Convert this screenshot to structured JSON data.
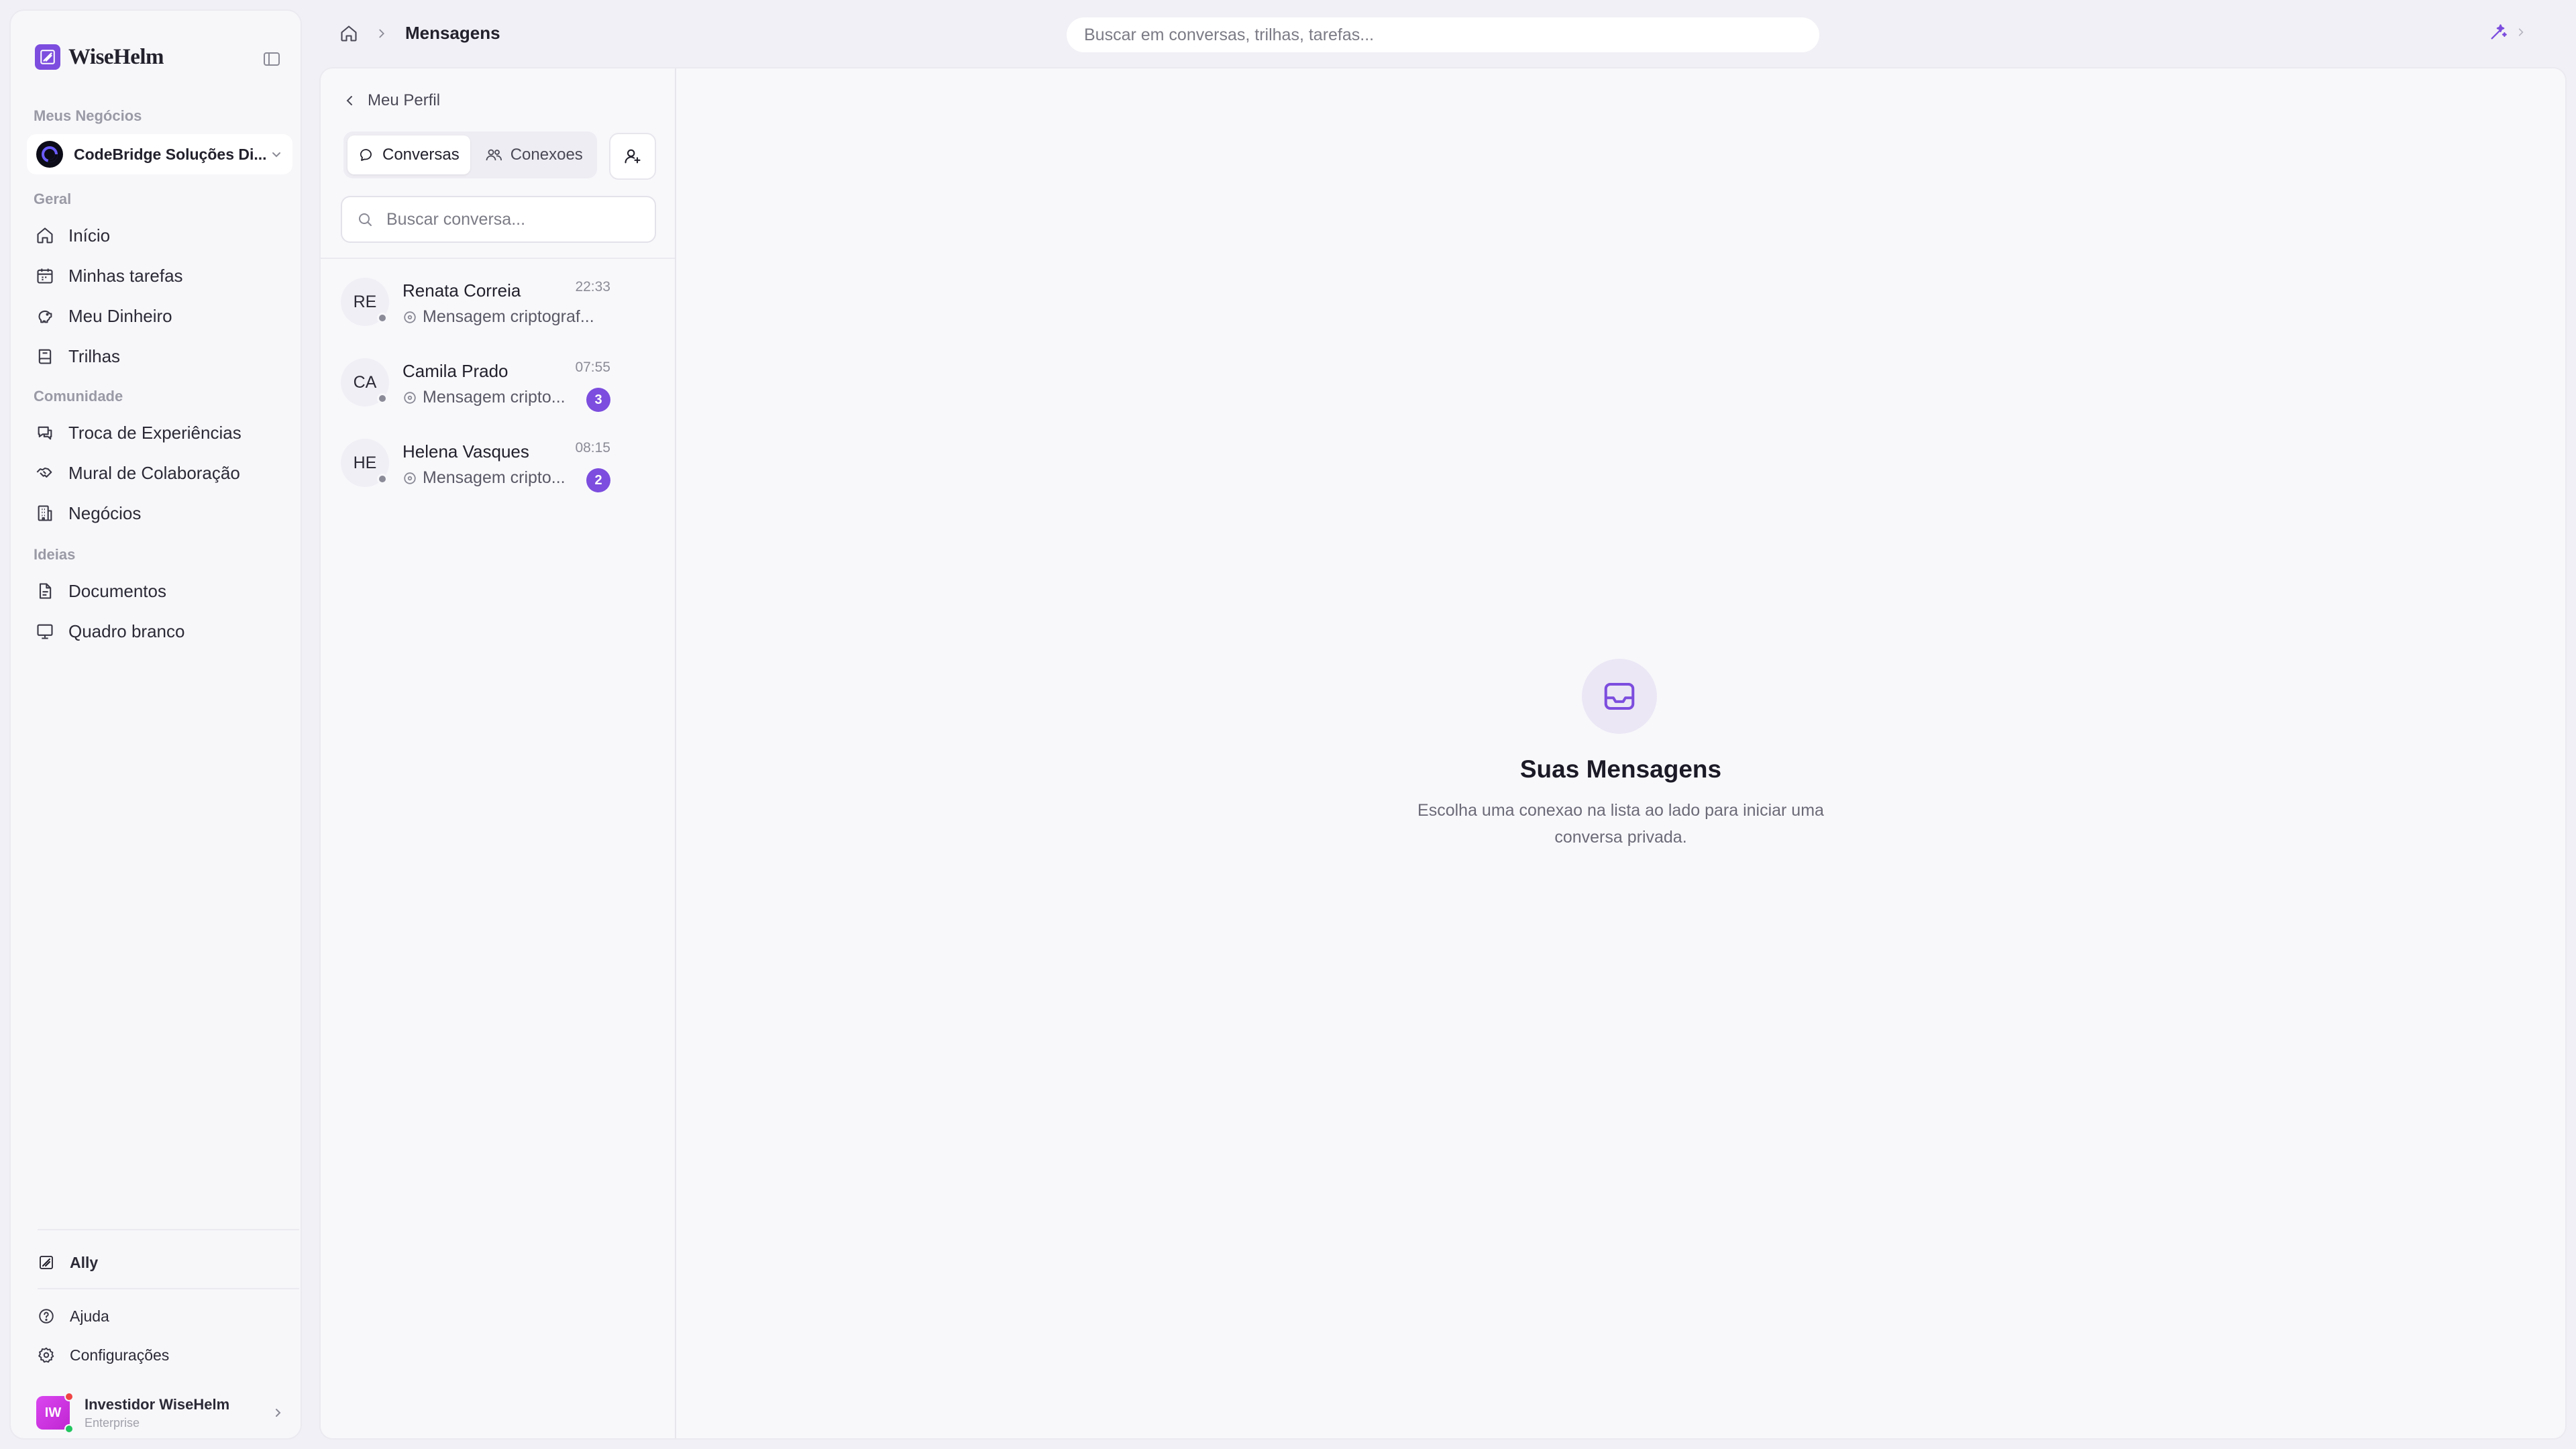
{
  "brand": {
    "name": "WiseHelm"
  },
  "sidebar": {
    "business_section": "Meus Negócios",
    "business_name": "CodeBridge Soluções Di...",
    "sections": [
      {
        "label": "Geral",
        "items": [
          {
            "label": "Início",
            "icon": "home-icon"
          },
          {
            "label": "Minhas tarefas",
            "icon": "calendar-icon"
          },
          {
            "label": "Meu Dinheiro",
            "icon": "piggy-bank-icon"
          },
          {
            "label": "Trilhas",
            "icon": "book-icon"
          }
        ]
      },
      {
        "label": "Comunidade",
        "items": [
          {
            "label": "Troca de Experiências",
            "icon": "chat-bubbles-icon"
          },
          {
            "label": "Mural de Colaboração",
            "icon": "handshake-icon"
          },
          {
            "label": "Negócios",
            "icon": "building-icon"
          }
        ]
      },
      {
        "label": "Ideias",
        "items": [
          {
            "label": "Documentos",
            "icon": "document-icon"
          },
          {
            "label": "Quadro branco",
            "icon": "whiteboard-icon"
          }
        ]
      }
    ],
    "bottom": {
      "ally": "Ally",
      "help": "Ajuda",
      "settings": "Configurações"
    },
    "user": {
      "initials": "IW",
      "name": "Investidor WiseHelm",
      "plan": "Enterprise"
    }
  },
  "topbar": {
    "breadcrumb_current": "Mensagens",
    "search_placeholder": "Buscar em conversas, trilhas, tarefas..."
  },
  "messages": {
    "back_label": "Meu Perfil",
    "tabs": [
      {
        "label": "Conversas",
        "active": true
      },
      {
        "label": "Conexoes",
        "active": false
      }
    ],
    "search_placeholder": "Buscar conversa...",
    "conversations": [
      {
        "initials": "RE",
        "name": "Renata Correia",
        "time": "22:33",
        "preview": "Mensagem criptograf...",
        "unread": ""
      },
      {
        "initials": "CA",
        "name": "Camila Prado",
        "time": "07:55",
        "preview": "Mensagem cripto...",
        "unread": "3"
      },
      {
        "initials": "HE",
        "name": "Helena Vasques",
        "time": "08:15",
        "preview": "Mensagem cripto...",
        "unread": "2"
      }
    ],
    "empty_title": "Suas Mensagens",
    "empty_desc": "Escolha uma conexao na lista ao lado para iniciar uma conversa privada."
  },
  "colors": {
    "accent": "#7c4dde",
    "badge": "#7c4dde"
  }
}
